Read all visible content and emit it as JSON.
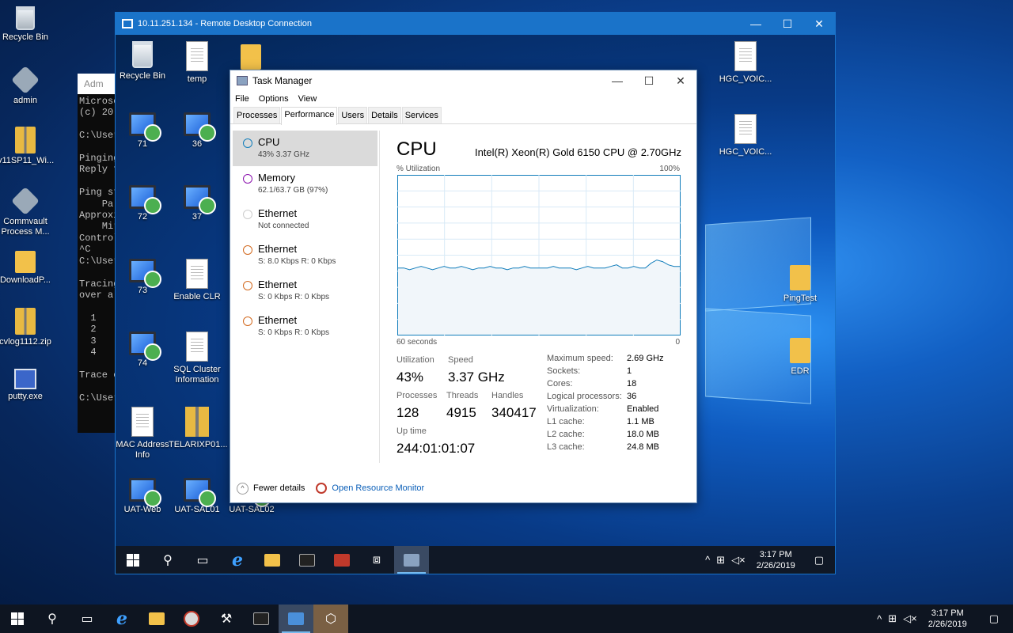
{
  "host_desktop": {
    "icons": [
      {
        "label": "Recycle Bin"
      },
      {
        "label": "admin"
      },
      {
        "label": "v11SP11_Wi..."
      },
      {
        "label": "Commvault Process M..."
      },
      {
        "label": "DownloadP..."
      },
      {
        "label": "cvlog1112.zip"
      },
      {
        "label": "putty.exe"
      }
    ]
  },
  "console": {
    "title": "Adm",
    "lines": [
      "Microsc",
      "(c) 20",
      "",
      "C:\\User",
      "",
      "Pinging",
      "Reply f",
      "",
      "Ping st",
      "    Pa",
      "Approxi",
      "    Mir",
      "Control",
      "^C",
      "C:\\User",
      "",
      "Tracing",
      "over a",
      "",
      "  1",
      "  2",
      "  3",
      "  4",
      "",
      "Trace c",
      "",
      "C:\\User"
    ]
  },
  "rdp": {
    "title": "10.11.251.134 - Remote Desktop Connection",
    "desktop_icons": [
      {
        "label": "Recycle Bin"
      },
      {
        "label": "temp"
      },
      {
        "label": ""
      },
      {
        "label": "71"
      },
      {
        "label": "36"
      },
      {
        "label": "72"
      },
      {
        "label": "37"
      },
      {
        "label": "73"
      },
      {
        "label": "Enable CLR"
      },
      {
        "label": "74"
      },
      {
        "label": "SQL Cluster Information"
      },
      {
        "label": "MAC Address Info"
      },
      {
        "label": "TELARIXP01..."
      },
      {
        "label": "UAT-Web"
      },
      {
        "label": "UAT-SAL01"
      },
      {
        "label": "UAT-SAL02"
      },
      {
        "label": "HGC_VOIC..."
      },
      {
        "label": "HGC_VOIC..."
      },
      {
        "label": "PingTest"
      },
      {
        "label": "EDR"
      }
    ],
    "taskbar": {
      "time": "3:17 PM",
      "date": "2/26/2019"
    }
  },
  "task_manager": {
    "title": "Task Manager",
    "menu": [
      "File",
      "Options",
      "View"
    ],
    "tabs": [
      "Processes",
      "Performance",
      "Users",
      "Details",
      "Services"
    ],
    "active_tab": "Performance",
    "resources": [
      {
        "name": "CPU",
        "detail": "43%  3.37 GHz",
        "color": "#117dbb"
      },
      {
        "name": "Memory",
        "detail": "62.1/63.7 GB (97%)",
        "color": "#8b12ae"
      },
      {
        "name": "Ethernet",
        "detail": "Not connected",
        "color": "#cccccc"
      },
      {
        "name": "Ethernet",
        "detail": "S: 8.0 Kbps  R: 0 Kbps",
        "color": "#d2691e"
      },
      {
        "name": "Ethernet",
        "detail": "S: 0 Kbps  R: 0 Kbps",
        "color": "#d2691e"
      },
      {
        "name": "Ethernet",
        "detail": "S: 0 Kbps  R: 0 Kbps",
        "color": "#d2691e"
      }
    ],
    "cpu": {
      "heading": "CPU",
      "model": "Intel(R) Xeon(R) Gold 6150 CPU @ 2.70GHz",
      "graph_label": "% Utilization",
      "graph_max": "100%",
      "graph_time": "60 seconds",
      "graph_min": "0",
      "utilization_history": [
        42,
        42,
        41,
        42,
        43,
        42,
        41,
        42,
        43,
        42,
        42,
        43,
        42,
        41,
        42,
        42,
        43,
        42,
        42,
        41,
        42,
        42,
        43,
        42,
        42,
        42,
        42,
        43,
        42,
        42,
        42,
        41,
        42,
        43,
        42,
        42,
        42,
        43,
        44,
        42,
        42,
        43,
        42,
        42,
        45,
        47,
        46,
        44,
        43,
        43
      ],
      "utilization_label": "Utilization",
      "utilization": "43%",
      "speed_label": "Speed",
      "speed": "3.37 GHz",
      "processes_label": "Processes",
      "processes": "128",
      "threads_label": "Threads",
      "threads": "4915",
      "handles_label": "Handles",
      "handles": "340417",
      "uptime_label": "Up time",
      "uptime": "244:01:01:07",
      "specs": [
        {
          "k": "Maximum speed:",
          "v": "2.69 GHz"
        },
        {
          "k": "Sockets:",
          "v": "1"
        },
        {
          "k": "Cores:",
          "v": "18"
        },
        {
          "k": "Logical processors:",
          "v": "36"
        },
        {
          "k": "Virtualization:",
          "v": "Enabled"
        },
        {
          "k": "L1 cache:",
          "v": "1.1 MB"
        },
        {
          "k": "L2 cache:",
          "v": "18.0 MB"
        },
        {
          "k": "L3 cache:",
          "v": "24.8 MB"
        }
      ]
    },
    "footer": {
      "fewer_details": "Fewer details",
      "resource_monitor": "Open Resource Monitor"
    }
  },
  "host_taskbar": {
    "time": "3:17 PM",
    "date": "2/26/2019"
  }
}
